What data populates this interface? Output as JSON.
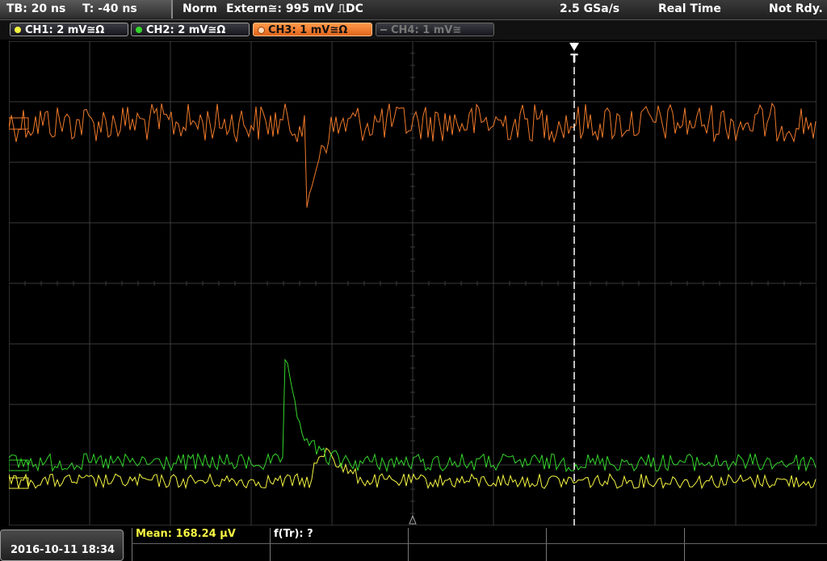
{
  "status": {
    "timebase": "TB: 20 ns",
    "trigger_time": "T: -40 ns",
    "mode": "Norm",
    "trigger_source": "Extern≅: 995 mV ⎍DC",
    "sample_rate": "2.5 GSa/s",
    "acq_mode": "Real Time",
    "state": "Not Rdy."
  },
  "channels": [
    {
      "label": "CH1: 2 mV≅Ω",
      "color": "#f5f542",
      "active": false,
      "enabled": true
    },
    {
      "label": "CH2: 2 mV≅Ω",
      "color": "#34d62c",
      "active": false,
      "enabled": true
    },
    {
      "label": "CH3: 1 mV≅Ω",
      "color": "#f07a2a",
      "active": true,
      "enabled": true
    },
    {
      "label": "CH4: 1 mV≅",
      "color": "#777777",
      "active": false,
      "enabled": false
    }
  ],
  "trigger_marker": "T",
  "footer": {
    "datetime": "2016-10-11 18:34",
    "measurement_1": "Mean: 168.24 µV",
    "measurement_2": "f(Tr): ?"
  },
  "colors": {
    "ch1": "#f5f542",
    "ch2": "#34d62c",
    "ch3": "#f07a2a",
    "grid": "#3a3a3a"
  }
}
